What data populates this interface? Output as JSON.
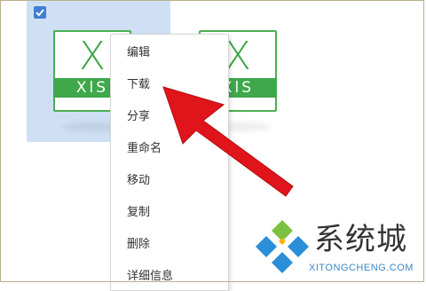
{
  "files": [
    {
      "letter": "X",
      "band": "XlS",
      "selected": true
    },
    {
      "letter": "X",
      "band": "XlS",
      "selected": false
    }
  ],
  "context_menu": {
    "items": [
      {
        "label": "编辑"
      },
      {
        "label": "下载"
      },
      {
        "label": "分享"
      },
      {
        "label": "重命名"
      },
      {
        "label": "移动"
      },
      {
        "label": "复制"
      },
      {
        "label": "删除"
      },
      {
        "label": "详细信息"
      }
    ]
  },
  "watermark": {
    "name": "系统城",
    "domain": "XITONGCHENG.COM"
  },
  "colors": {
    "selection": "#cfe0f4",
    "excel_green": "#3ea84a",
    "checkbox": "#3f7fd3",
    "arrow": "#e0141b"
  },
  "icons": {
    "checkbox": "checkmark-icon",
    "file": "xls-file-icon",
    "logo": "xitongcheng-logo-icon"
  }
}
